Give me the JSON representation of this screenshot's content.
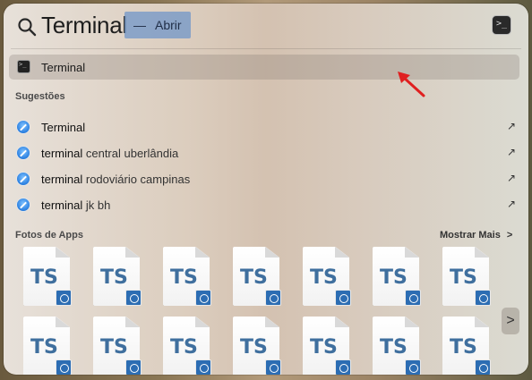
{
  "search": {
    "query": "Terminal",
    "autocomplete_dash": "—",
    "autocomplete_action": "Abrir",
    "top_app_icon": "terminal-icon"
  },
  "top_hit": {
    "label": "Terminal",
    "icon": "terminal-icon"
  },
  "suggestions_section": {
    "title": "Sugestões"
  },
  "suggestions": [
    {
      "bold": "Terminal",
      "rest": "",
      "icon": "safari-icon"
    },
    {
      "bold": "terminal",
      "rest": " central uberlândia",
      "icon": "safari-icon"
    },
    {
      "bold": "terminal",
      "rest": " rodoviário campinas",
      "icon": "safari-icon"
    },
    {
      "bold": "terminal",
      "rest": " jk bh",
      "icon": "safari-icon"
    }
  ],
  "app_photos": {
    "title": "Fotos de Apps",
    "show_more": "Mostrar Mais",
    "show_more_chevron": ">",
    "next_chevron": ">",
    "tile_text": "TS",
    "tile_count": 14
  },
  "colors": {
    "accent_selection": "#7096c8",
    "ts_text": "#3f6f9e",
    "pointer": "#e02020"
  }
}
